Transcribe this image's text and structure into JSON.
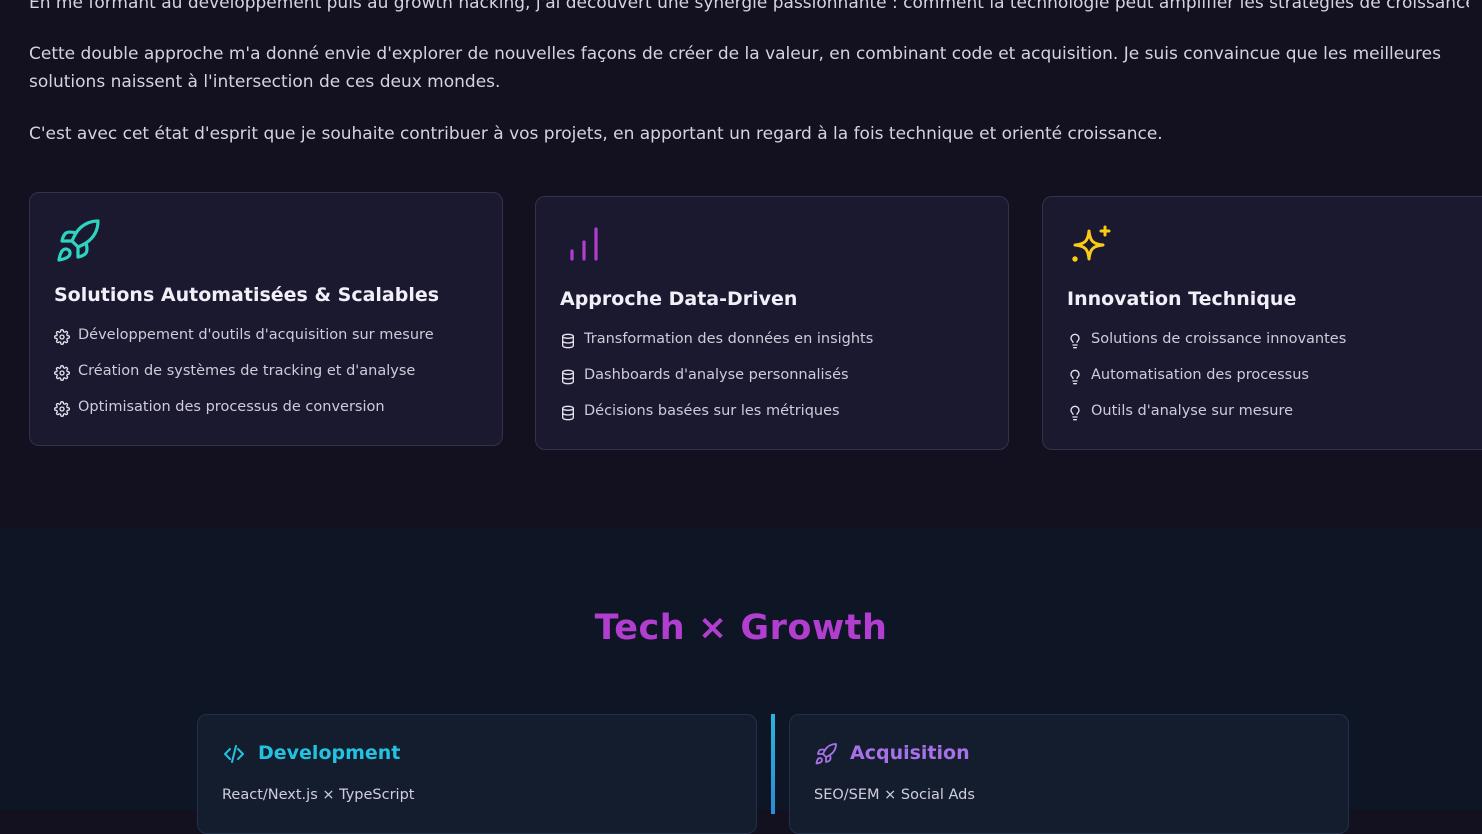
{
  "about": {
    "paragraphs": [
      "En me formant au développement puis au growth hacking, j'ai découvert une synergie passionnante : comment la technologie peut amplifier les stratégies de croissance.",
      "Cette double approche m'a donné envie d'explorer de nouvelles façons de créer de la valeur, en combinant code et acquisition. Je suis convaincue que les meilleures solutions naissent à l'intersection de ces deux mondes.",
      "C'est avec cet état d'esprit que je souhaite contribuer à vos projets, en apportant un regard à la fois technique et orienté croissance."
    ]
  },
  "cards": [
    {
      "icon": "rocket-icon",
      "title": "Solutions Automatisées & Scalables",
      "bullet_icon": "gear-icon",
      "items": [
        "Développement d'outils d'acquisition sur mesure",
        "Création de systèmes de tracking et d'analyse",
        "Optimisation des processus de conversion"
      ]
    },
    {
      "icon": "bar-chart-icon",
      "title": "Approche Data-Driven",
      "bullet_icon": "database-icon",
      "items": [
        "Transformation des données en insights",
        "Dashboards d'analyse personnalisés",
        "Décisions basées sur les métriques"
      ]
    },
    {
      "icon": "sparkles-icon",
      "title": "Innovation Technique",
      "bullet_icon": "lightbulb-icon",
      "items": [
        "Solutions de croissance innovantes",
        "Automatisation des processus",
        "Outils d'analyse sur mesure"
      ]
    }
  ],
  "tech": {
    "title": "Tech × Growth",
    "development": {
      "icon": "code-icon",
      "label": "Development",
      "stack": "React/Next.js × TypeScript"
    },
    "acquisition": {
      "icon": "rocket-icon",
      "label": "Acquisition",
      "stack": "SEO/SEM × Social Ads"
    }
  },
  "colors": {
    "background": "#13111f",
    "card": "#1b1930",
    "teal": "#2dd4bf",
    "purple": "#b23ecf",
    "yellow": "#facc15",
    "cyan": "#22c2e0",
    "violet": "#a772e8"
  }
}
